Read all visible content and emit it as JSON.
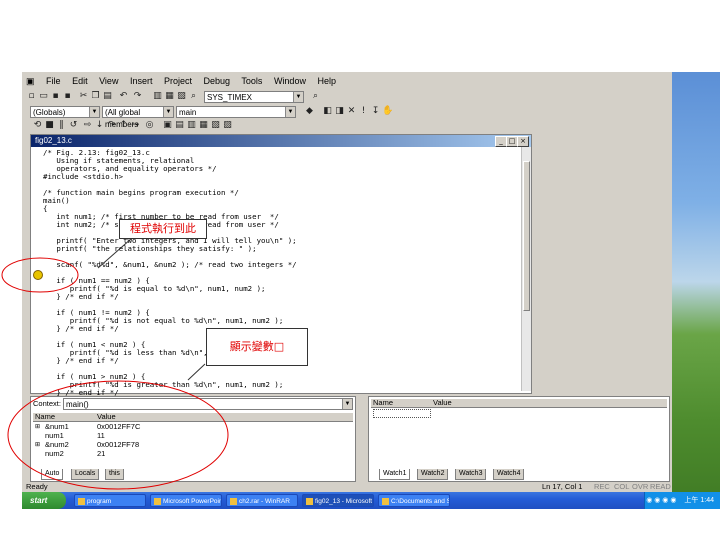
{
  "menu": [
    "File",
    "Edit",
    "View",
    "Insert",
    "Project",
    "Debug",
    "Tools",
    "Window",
    "Help"
  ],
  "toolbar": {
    "config_combo": "SYS_TIMEX",
    "class_combo": "(Globals)",
    "members_combo": "(All global members",
    "function_combo": "main"
  },
  "editor": {
    "title": "fig02_13.c",
    "code": [
      "/* Fig. 2.13: fig02_13.c",
      "   Using if statements, relational",
      "   operators, and equality operators */",
      "#include <stdio.h>",
      "",
      "/* function main begins program execution */",
      "main()",
      "{",
      "   int num1; /* first number to be read from user  */",
      "   int num2; /* second number to be read from user */",
      "",
      "   printf( \"Enter two integers, and I will tell you\\n\" );",
      "   printf( \"the relationships they satisfy: \" );",
      "",
      "   scanf( \"%d%d\", &num1, &num2 ); /* read two integers */",
      "",
      "   if ( num1 == num2 ) {",
      "      printf( \"%d is equal to %d\\n\", num1, num2 );",
      "   } /* end if */",
      "",
      "   if ( num1 != num2 ) {",
      "      printf( \"%d is not equal to %d\\n\", num1, num2 );",
      "   } /* end if */",
      "",
      "   if ( num1 < num2 ) {",
      "      printf( \"%d is less than %d\\n\", num1, num2 );",
      "   } /* end if */",
      "",
      "   if ( num1 > num2 ) {",
      "      printf( \"%d is greater than %d\\n\", num1, num2 );",
      "   } /* end if */"
    ]
  },
  "variables": {
    "context_label": "Context:",
    "context_value": "main()",
    "col_name": "Name",
    "col_value": "Value",
    "rows": [
      {
        "name": "&num1",
        "value": "0x0012FF7C"
      },
      {
        "name": "num1",
        "value": "11"
      },
      {
        "name": "&num2",
        "value": "0x0012FF78"
      },
      {
        "name": "num2",
        "value": "21"
      }
    ],
    "tabs": [
      "Auto",
      "Locals",
      "this"
    ]
  },
  "watch": {
    "col_name": "Name",
    "col_value": "Value",
    "tabs": [
      "Watch1",
      "Watch2",
      "Watch3",
      "Watch4"
    ]
  },
  "status": {
    "left": "Ready",
    "position": "Ln 17, Col 1",
    "flags": [
      "REC",
      "COL",
      "OVR",
      "READ"
    ]
  },
  "taskbar": {
    "start": "start",
    "tasks": [
      "program",
      "Microsoft PowerPoint",
      "ch2.rar - WinRAR",
      "fig02_13 - Microsoft",
      "C:\\Documents and Set"
    ],
    "clock": "上午 1:44"
  },
  "callouts": {
    "breakpoint_note": "程式執行到此",
    "vars_note": "顯示變數□"
  },
  "colors": {
    "annotation_red": "#e00000",
    "title_blue": "#0a246a",
    "taskbar_blue": "#245dd7"
  }
}
